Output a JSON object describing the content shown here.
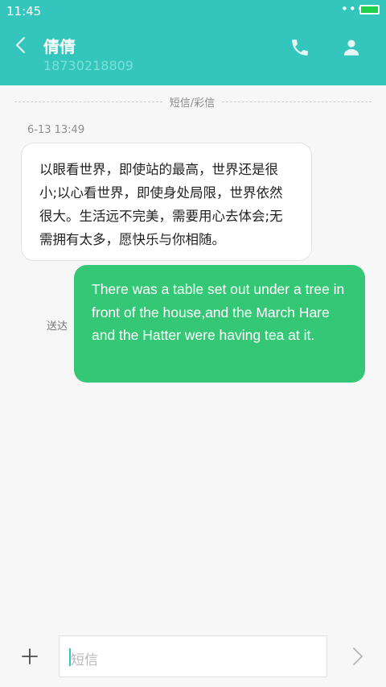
{
  "status_bar": {
    "time": "11:45",
    "dots": "•••",
    "battery_color": "#22d14b"
  },
  "header": {
    "contact_name": "倩倩",
    "contact_number": "18730218809",
    "background_color": "#34c6bd",
    "icons": [
      "back-arrow-icon",
      "phone-icon",
      "person-icon"
    ]
  },
  "conversation": {
    "divider_label": "短信/彩信",
    "timestamp": "6-13 13:49",
    "messages": [
      {
        "direction": "incoming",
        "text": "以眼看世界，即使站的最高，世界还是很小;以心看世界，即使身处局限，世界依然很大。生活远不完美，需要用心去体会;无需拥有太多，愿快乐与你相随。"
      },
      {
        "direction": "outgoing",
        "text": "There was a table set out under a tree in front of the house,and the March Hare and the Hatter were having tea at it.",
        "status": "送达",
        "bubble_color": "#34c775"
      }
    ]
  },
  "composer": {
    "placeholder": "短信",
    "icons": [
      "plus-icon",
      "send-chevron-icon"
    ]
  }
}
